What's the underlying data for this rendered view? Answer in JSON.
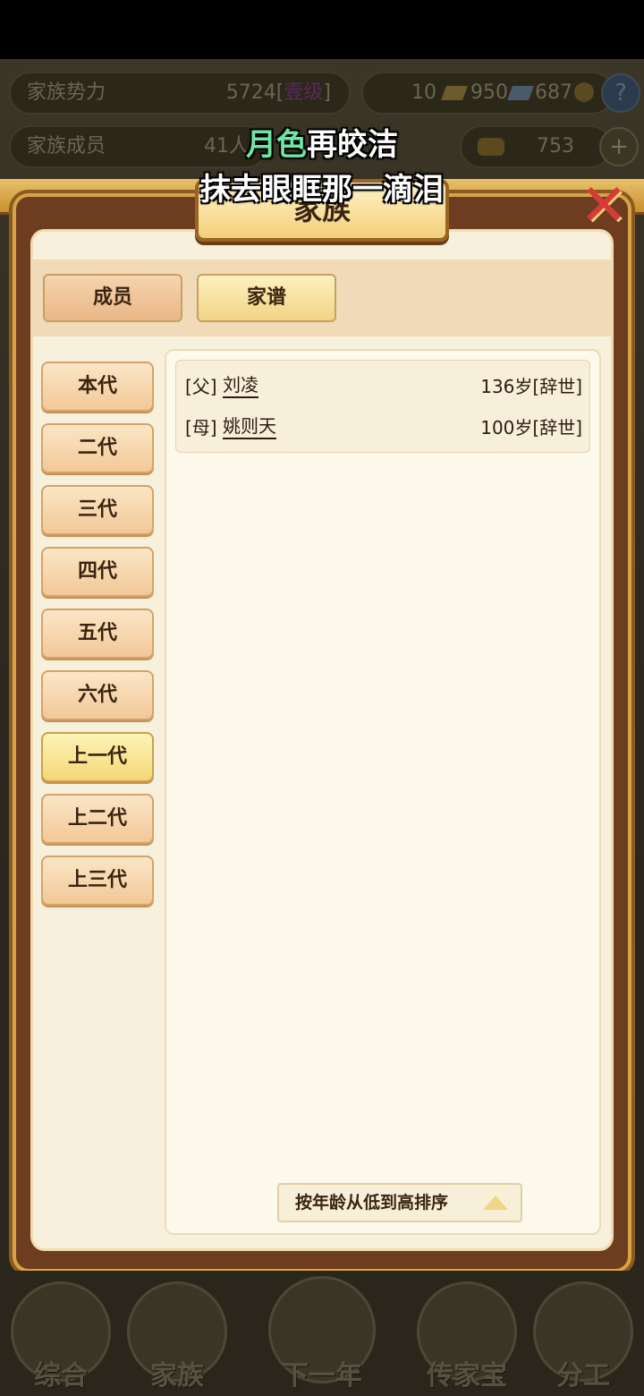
{
  "background": {
    "clan_power_label": "家族势力",
    "clan_power_value": "5724[",
    "clan_power_rank": "壹级",
    "clan_power_close": "]",
    "resources_text": "10",
    "gold_count": "950",
    "silver_count": "687",
    "clan_members_label": "家族成员",
    "clan_members_value": "41人",
    "ingot_count": "753",
    "help_symbol": "?",
    "plus_symbol": "+"
  },
  "lyric": {
    "line1_highlight": "月色",
    "line1_rest": "再皎洁",
    "line2": "抹去眼眶那一滴泪"
  },
  "panel": {
    "title": "家族",
    "close_symbol": "✕"
  },
  "tabs": [
    {
      "label": "成员",
      "active": false
    },
    {
      "label": "家谱",
      "active": true
    }
  ],
  "generations": [
    {
      "label": "本代",
      "active": false
    },
    {
      "label": "二代",
      "active": false
    },
    {
      "label": "三代",
      "active": false
    },
    {
      "label": "四代",
      "active": false
    },
    {
      "label": "五代",
      "active": false
    },
    {
      "label": "六代",
      "active": false
    },
    {
      "label": "上一代",
      "active": true
    },
    {
      "label": "上二代",
      "active": false
    },
    {
      "label": "上三代",
      "active": false
    }
  ],
  "members": [
    {
      "relation": "[父]",
      "name": "刘凌",
      "age": "136岁[辞世]"
    },
    {
      "relation": "[母]",
      "name": "姚则天",
      "age": "100岁[辞世]"
    }
  ],
  "sort_button": "按年龄从低到高排序",
  "bottom_nav": [
    "综合",
    "家族",
    "下一年",
    "传家宝",
    "分工"
  ]
}
